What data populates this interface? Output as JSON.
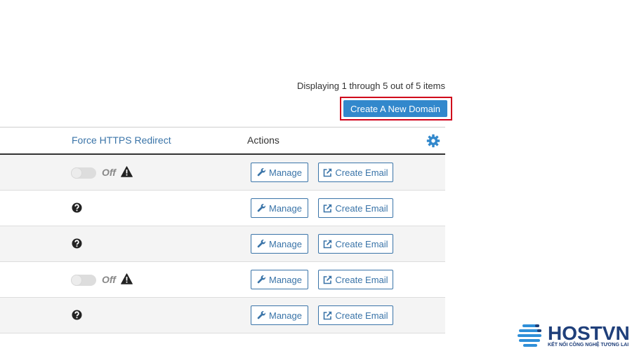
{
  "pagination": {
    "display_text": "Displaying 1 through 5 out of 5 items"
  },
  "create_button": {
    "label": "Create A New Domain"
  },
  "table": {
    "headers": {
      "force_https": "Force HTTPS Redirect",
      "actions": "Actions"
    },
    "settings_icon": "gear-icon",
    "rows": [
      {
        "https_state": "toggle-off",
        "toggle_label": "Off",
        "status_icon": "warning-icon",
        "manage_label": "Manage",
        "email_label": "Create Email"
      },
      {
        "https_state": "unknown",
        "status_icon": "question-circle-icon",
        "manage_label": "Manage",
        "email_label": "Create Email"
      },
      {
        "https_state": "unknown",
        "status_icon": "question-circle-icon",
        "manage_label": "Manage",
        "email_label": "Create Email"
      },
      {
        "https_state": "toggle-off",
        "toggle_label": "Off",
        "status_icon": "warning-icon",
        "manage_label": "Manage",
        "email_label": "Create Email"
      },
      {
        "https_state": "unknown",
        "status_icon": "question-circle-icon",
        "manage_label": "Manage",
        "email_label": "Create Email"
      }
    ]
  },
  "watermark": {
    "brand": "HOSTVN",
    "tagline": "KẾT NỐI CÔNG NGHỆ TƯƠNG LAI"
  },
  "colors": {
    "accent": "#3288cc",
    "link": "#3a74a8",
    "highlight_border": "#d0021b",
    "logo": "#1f3f7a"
  }
}
